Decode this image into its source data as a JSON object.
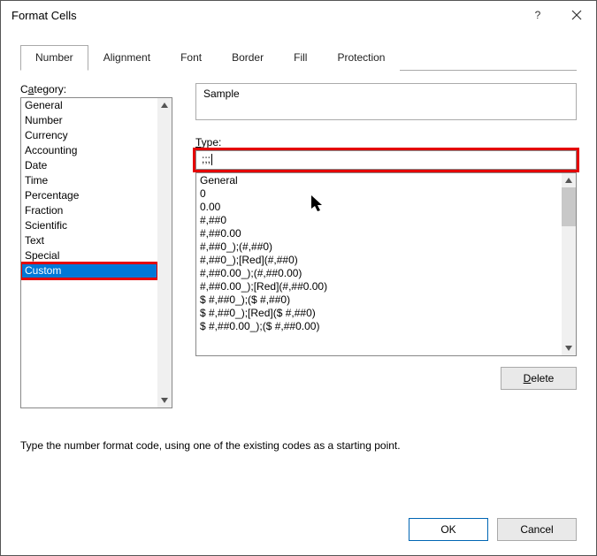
{
  "title": "Format Cells",
  "tabs": [
    "Number",
    "Alignment",
    "Font",
    "Border",
    "Fill",
    "Protection"
  ],
  "activeTab": 0,
  "category": {
    "label_pre": "C",
    "label_u": "a",
    "label_post": "tegory:",
    "items": [
      "General",
      "Number",
      "Currency",
      "Accounting",
      "Date",
      "Time",
      "Percentage",
      "Fraction",
      "Scientific",
      "Text",
      "Special",
      "Custom"
    ],
    "selectedIndex": 11
  },
  "sample": {
    "label": "Sample",
    "value": ""
  },
  "type": {
    "label_u": "T",
    "label_post": "ype:",
    "value": ";;;"
  },
  "formats": [
    "General",
    "0",
    "0.00",
    "#,##0",
    "#,##0.00",
    "#,##0_);(#,##0)",
    "#,##0_);[Red](#,##0)",
    "#,##0.00_);(#,##0.00)",
    "#,##0.00_);[Red](#,##0.00)",
    "$ #,##0_);($ #,##0)",
    "$ #,##0_);[Red]($ #,##0)",
    "$ #,##0.00_);($ #,##0.00)"
  ],
  "deleteLabel_u": "D",
  "deleteLabel_post": "elete",
  "hint": "Type the number format code, using one of the existing codes as a starting point.",
  "ok": "OK",
  "cancel": "Cancel",
  "help": "?",
  "close": "✕"
}
